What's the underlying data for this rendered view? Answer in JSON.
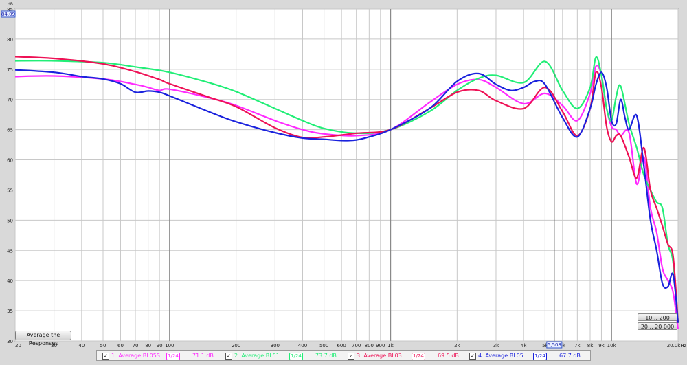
{
  "chart_data": {
    "type": "line",
    "x_scale": "log",
    "xlim": [
      20,
      20000
    ],
    "ylim": [
      30,
      85
    ],
    "yunit": "dB",
    "y_ticks": [
      30,
      35,
      40,
      45,
      50,
      55,
      60,
      65,
      70,
      75,
      80,
      85
    ],
    "x_ticks": [
      20,
      30,
      40,
      50,
      60,
      70,
      80,
      90,
      100,
      200,
      300,
      400,
      500,
      600,
      700,
      800,
      900,
      1000,
      2000,
      3000,
      4000,
      5000,
      6000,
      7000,
      8000,
      9000,
      10000,
      20000
    ],
    "x_tick_labels": [
      "20",
      "30",
      "40",
      "50",
      "60",
      "70",
      "80",
      "90",
      "100",
      "200",
      "300",
      "400",
      "500",
      "600",
      "700",
      "800",
      "900",
      "1k",
      "2k",
      "3k",
      "4k",
      "5k",
      "6k",
      "7k",
      "8k",
      "9k",
      "10k",
      "20.0kHz"
    ],
    "grid": true,
    "cursor_readouts": {
      "y": "84.09",
      "x": "5,508"
    },
    "series": [
      {
        "name": "1: Average BL05S",
        "color": "#ff2bff",
        "value": "71.1 dB",
        "x": [
          20,
          30,
          50,
          70,
          80,
          90,
          100,
          150,
          200,
          300,
          400,
          500,
          700,
          1000,
          1500,
          2000,
          2500,
          3000,
          4000,
          5000,
          6000,
          7000,
          8000,
          8500,
          9000,
          9500,
          10000,
          10500,
          11000,
          12000,
          13000,
          14000,
          15000,
          16000,
          17000,
          18000,
          19000,
          20000
        ],
        "y": [
          73.8,
          73.9,
          73.4,
          72.5,
          72,
          71.5,
          71.7,
          70.3,
          69,
          66.5,
          65,
          64.3,
          64,
          65,
          69.5,
          72.5,
          73.3,
          72,
          69.3,
          71,
          69,
          66.5,
          71,
          75.5,
          74,
          68.5,
          65.5,
          65,
          64,
          64.5,
          56,
          60.5,
          52,
          48,
          42,
          40,
          38,
          32
        ]
      },
      {
        "name": "2: Average BL51",
        "color": "#22ee77",
        "value": "73.7 dB",
        "x": [
          20,
          30,
          50,
          70,
          100,
          150,
          200,
          300,
          400,
          500,
          700,
          1000,
          1500,
          2000,
          2500,
          3000,
          4000,
          5000,
          6000,
          7000,
          8000,
          8500,
          9000,
          9500,
          10000,
          10500,
          11000,
          12000,
          13000,
          14000,
          15000,
          16000,
          17000,
          18000,
          19000,
          20000
        ],
        "y": [
          76.4,
          76.4,
          76.1,
          75.4,
          74.5,
          72.8,
          71.3,
          68.5,
          66.5,
          65.2,
          64.4,
          65,
          68,
          71.5,
          73.5,
          74,
          72.8,
          76.3,
          71.5,
          68.5,
          72,
          77,
          74,
          68.5,
          66.5,
          70.5,
          72.2,
          66,
          62,
          57.5,
          55,
          53,
          52,
          46,
          43,
          33
        ]
      },
      {
        "name": "3: Average BL03",
        "color": "#ee1155",
        "value": "69.5 dB",
        "x": [
          20,
          30,
          50,
          70,
          90,
          100,
          150,
          200,
          300,
          400,
          500,
          700,
          1000,
          1500,
          2000,
          2500,
          3000,
          4000,
          5000,
          6000,
          7000,
          8000,
          8500,
          9000,
          9500,
          10000,
          10500,
          11000,
          12000,
          13000,
          14000,
          15000,
          16000,
          17000,
          18000,
          19000,
          20000
        ],
        "y": [
          77.1,
          76.8,
          75.9,
          74.6,
          73.3,
          72.6,
          70.4,
          68.8,
          65.3,
          63.7,
          63.8,
          64.4,
          65,
          68.5,
          71.2,
          71.5,
          69.8,
          68.5,
          72,
          68,
          64,
          68.5,
          74.5,
          72,
          65.5,
          63,
          64,
          64,
          60.5,
          57,
          62,
          55,
          52,
          49,
          46,
          44,
          33
        ]
      },
      {
        "name": "4: Average BL05",
        "color": "#1a22dd",
        "value": "67.7 dB",
        "x": [
          20,
          30,
          40,
          50,
          60,
          70,
          80,
          90,
          100,
          150,
          200,
          300,
          400,
          500,
          600,
          700,
          800,
          1000,
          1500,
          2000,
          2500,
          3000,
          3500,
          4000,
          4500,
          5000,
          6000,
          7000,
          8000,
          8500,
          9000,
          9500,
          10000,
          10500,
          11000,
          11500,
          12000,
          13000,
          14000,
          15000,
          16000,
          17000,
          18000,
          19000,
          20000
        ],
        "y": [
          74.9,
          74.5,
          73.8,
          73.4,
          72.6,
          71.2,
          71.4,
          71.2,
          70.6,
          68,
          66.3,
          64.5,
          63.6,
          63.4,
          63.2,
          63.3,
          63.8,
          65,
          68.5,
          73,
          74.3,
          72.5,
          71.5,
          72,
          73,
          72.5,
          67,
          63.8,
          68.5,
          72.5,
          74.5,
          72,
          66.5,
          66,
          70,
          67,
          65,
          67.3,
          59,
          50,
          45,
          39.5,
          39,
          41,
          33
        ]
      }
    ]
  },
  "buttons": {
    "average_label": "Average the Responses",
    "range1": "10 .. 200",
    "range2": "20 .. 20 000"
  }
}
